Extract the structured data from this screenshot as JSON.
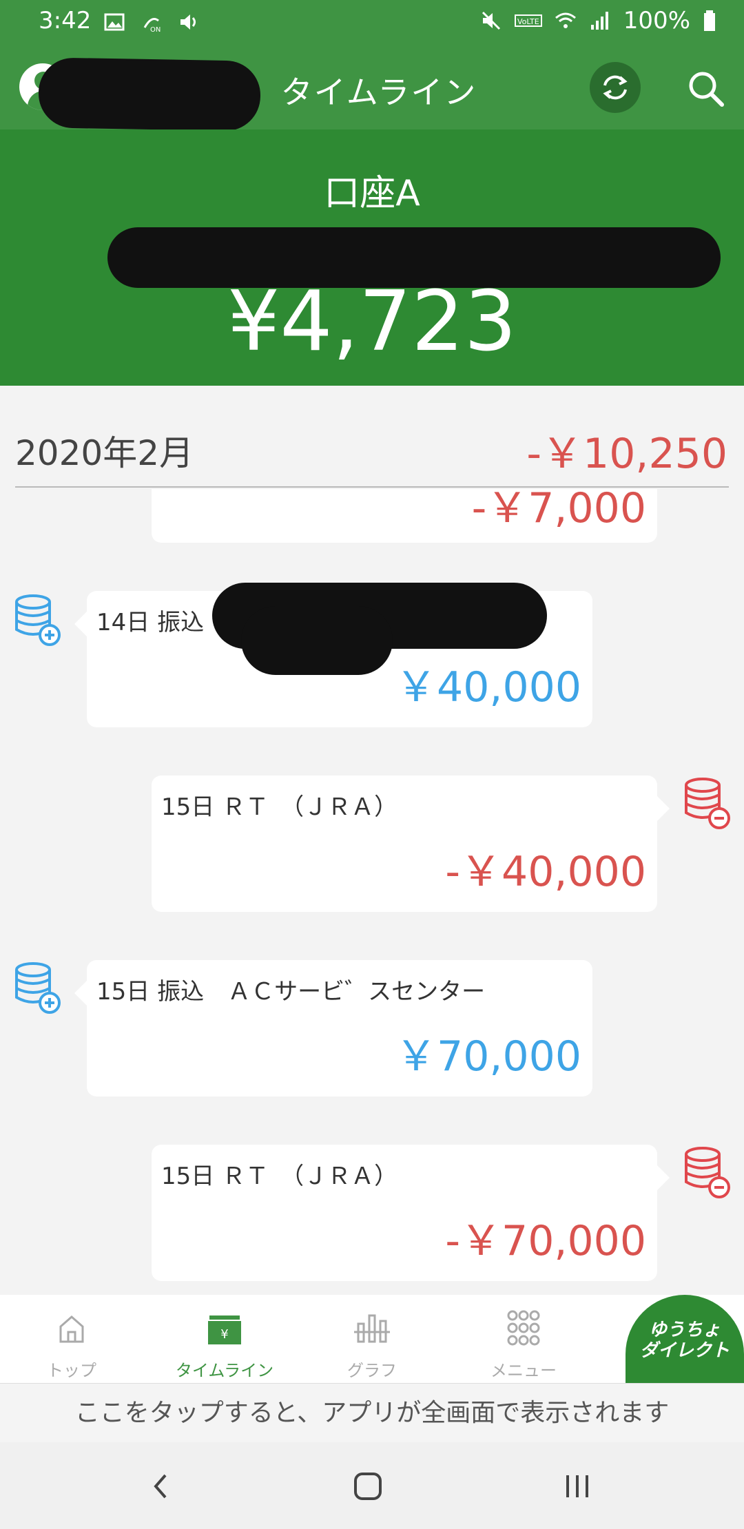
{
  "status_bar": {
    "time": "3:42",
    "battery": "100%",
    "icons": [
      "image-icon",
      "nfc-icon",
      "volume-icon",
      "mute-icon",
      "volte-icon",
      "wifi-icon",
      "signal-icon",
      "battery-icon"
    ]
  },
  "app_bar": {
    "title": "タイムライン"
  },
  "account": {
    "name": "口座A",
    "balance": "¥4,723"
  },
  "month": {
    "label": "2020年2月",
    "total": "-￥10,250"
  },
  "transactions": [
    {
      "desc": "",
      "amount": "-￥7,000",
      "type": "out"
    },
    {
      "desc": "14日 振込",
      "amount": "￥40,000",
      "type": "in"
    },
    {
      "desc": "15日 ＲＴ　（ＪＲＡ）",
      "amount": "-￥40,000",
      "type": "out"
    },
    {
      "desc": "15日 振込　ＡＣサービ゛スセンター",
      "amount": "￥70,000",
      "type": "in"
    },
    {
      "desc": "15日 ＲＴ　（ＪＲＡ）",
      "amount": "-￥70,000",
      "type": "out"
    }
  ],
  "bottom_nav": {
    "items": [
      {
        "label": "トップ",
        "icon": "home-icon"
      },
      {
        "label": "タイムライン",
        "icon": "wallet-icon"
      },
      {
        "label": "グラフ",
        "icon": "chart-icon"
      },
      {
        "label": "メニュー",
        "icon": "grid-icon"
      }
    ],
    "direct_line1": "ゆうちょ",
    "direct_line2": "ダイレクト"
  },
  "hint": "ここをタップすると、アプリが全画面で表示されます",
  "colors": {
    "brand_green": "#3f9443",
    "header_green": "#2e8a33",
    "income_blue": "#3ea4e6",
    "expense_red": "#d9534f"
  }
}
